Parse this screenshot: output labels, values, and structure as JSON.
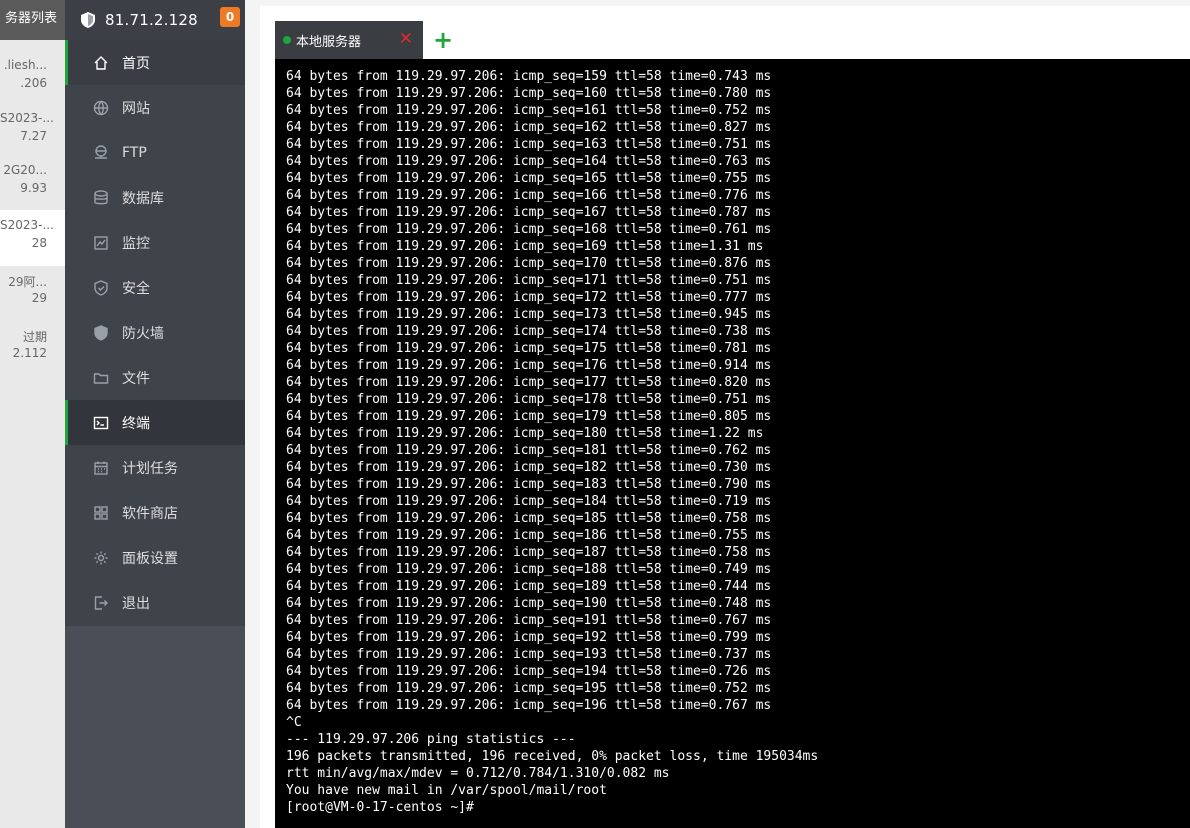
{
  "server_list": {
    "title": "务器列表",
    "items": [
      {
        "name": ".liesh...",
        "ip": ".206"
      },
      {
        "name": "S2023-...",
        "ip": "7.27"
      },
      {
        "name": "2G20...",
        "ip": "9.93"
      },
      {
        "name": "S2023-...",
        "ip": "28",
        "active": true
      },
      {
        "name": "29阿...",
        "ip": "29"
      },
      {
        "name": "过期",
        "ip": "2.112"
      }
    ]
  },
  "sidebar": {
    "ip": "81.71.2.128",
    "badge": "0",
    "items": [
      {
        "label": "首页",
        "icon": "home-icon",
        "active": true
      },
      {
        "label": "网站",
        "icon": "globe-icon"
      },
      {
        "label": "FTP",
        "icon": "ftp-icon"
      },
      {
        "label": "数据库",
        "icon": "database-icon"
      },
      {
        "label": "监控",
        "icon": "monitor-icon"
      },
      {
        "label": "安全",
        "icon": "security-shield-icon"
      },
      {
        "label": "防火墙",
        "icon": "firewall-shield-icon"
      },
      {
        "label": "文件",
        "icon": "folder-icon"
      },
      {
        "label": "终端",
        "icon": "terminal-icon",
        "active": true
      },
      {
        "label": "计划任务",
        "icon": "calendar-icon"
      },
      {
        "label": "软件商店",
        "icon": "apps-grid-icon"
      },
      {
        "label": "面板设置",
        "icon": "gear-icon"
      },
      {
        "label": "退出",
        "icon": "logout-icon"
      }
    ]
  },
  "tabs": [
    {
      "label": "本地服务器",
      "close": "✕"
    }
  ],
  "add_tab": "+",
  "colors": {
    "accent": "#20a53a",
    "badge": "#f07a23",
    "close": "#e02a2a"
  },
  "terminal": {
    "lines": [
      "64 bytes from 119.29.97.206: icmp_seq=159 ttl=58 time=0.743 ms",
      "64 bytes from 119.29.97.206: icmp_seq=160 ttl=58 time=0.780 ms",
      "64 bytes from 119.29.97.206: icmp_seq=161 ttl=58 time=0.752 ms",
      "64 bytes from 119.29.97.206: icmp_seq=162 ttl=58 time=0.827 ms",
      "64 bytes from 119.29.97.206: icmp_seq=163 ttl=58 time=0.751 ms",
      "64 bytes from 119.29.97.206: icmp_seq=164 ttl=58 time=0.763 ms",
      "64 bytes from 119.29.97.206: icmp_seq=165 ttl=58 time=0.755 ms",
      "64 bytes from 119.29.97.206: icmp_seq=166 ttl=58 time=0.776 ms",
      "64 bytes from 119.29.97.206: icmp_seq=167 ttl=58 time=0.787 ms",
      "64 bytes from 119.29.97.206: icmp_seq=168 ttl=58 time=0.761 ms",
      "64 bytes from 119.29.97.206: icmp_seq=169 ttl=58 time=1.31 ms",
      "64 bytes from 119.29.97.206: icmp_seq=170 ttl=58 time=0.876 ms",
      "64 bytes from 119.29.97.206: icmp_seq=171 ttl=58 time=0.751 ms",
      "64 bytes from 119.29.97.206: icmp_seq=172 ttl=58 time=0.777 ms",
      "64 bytes from 119.29.97.206: icmp_seq=173 ttl=58 time=0.945 ms",
      "64 bytes from 119.29.97.206: icmp_seq=174 ttl=58 time=0.738 ms",
      "64 bytes from 119.29.97.206: icmp_seq=175 ttl=58 time=0.781 ms",
      "64 bytes from 119.29.97.206: icmp_seq=176 ttl=58 time=0.914 ms",
      "64 bytes from 119.29.97.206: icmp_seq=177 ttl=58 time=0.820 ms",
      "64 bytes from 119.29.97.206: icmp_seq=178 ttl=58 time=0.751 ms",
      "64 bytes from 119.29.97.206: icmp_seq=179 ttl=58 time=0.805 ms",
      "64 bytes from 119.29.97.206: icmp_seq=180 ttl=58 time=1.22 ms",
      "64 bytes from 119.29.97.206: icmp_seq=181 ttl=58 time=0.762 ms",
      "64 bytes from 119.29.97.206: icmp_seq=182 ttl=58 time=0.730 ms",
      "64 bytes from 119.29.97.206: icmp_seq=183 ttl=58 time=0.790 ms",
      "64 bytes from 119.29.97.206: icmp_seq=184 ttl=58 time=0.719 ms",
      "64 bytes from 119.29.97.206: icmp_seq=185 ttl=58 time=0.758 ms",
      "64 bytes from 119.29.97.206: icmp_seq=186 ttl=58 time=0.755 ms",
      "64 bytes from 119.29.97.206: icmp_seq=187 ttl=58 time=0.758 ms",
      "64 bytes from 119.29.97.206: icmp_seq=188 ttl=58 time=0.749 ms",
      "64 bytes from 119.29.97.206: icmp_seq=189 ttl=58 time=0.744 ms",
      "64 bytes from 119.29.97.206: icmp_seq=190 ttl=58 time=0.748 ms",
      "64 bytes from 119.29.97.206: icmp_seq=191 ttl=58 time=0.767 ms",
      "64 bytes from 119.29.97.206: icmp_seq=192 ttl=58 time=0.799 ms",
      "64 bytes from 119.29.97.206: icmp_seq=193 ttl=58 time=0.737 ms",
      "64 bytes from 119.29.97.206: icmp_seq=194 ttl=58 time=0.726 ms",
      "64 bytes from 119.29.97.206: icmp_seq=195 ttl=58 time=0.752 ms",
      "64 bytes from 119.29.97.206: icmp_seq=196 ttl=58 time=0.767 ms",
      "^C",
      "--- 119.29.97.206 ping statistics ---",
      "196 packets transmitted, 196 received, 0% packet loss, time 195034ms",
      "rtt min/avg/max/mdev = 0.712/0.784/1.310/0.082 ms",
      "You have new mail in /var/spool/mail/root",
      "[root@VM-0-17-centos ~]#"
    ]
  }
}
